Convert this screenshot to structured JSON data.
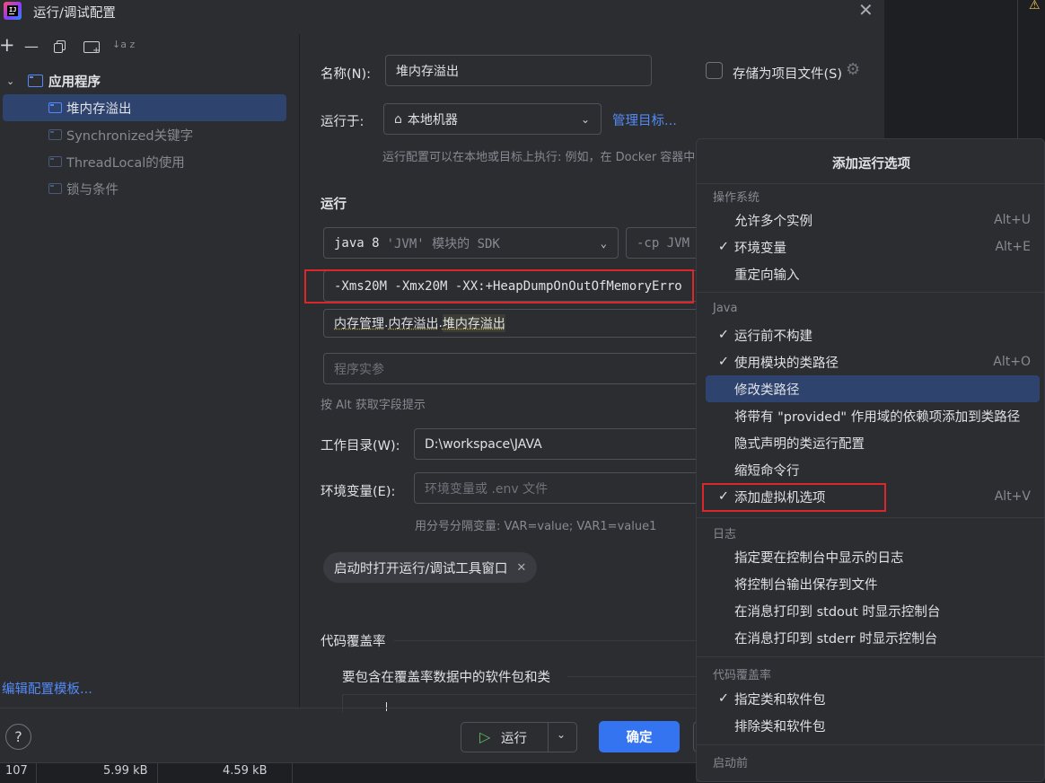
{
  "window": {
    "title": "运行/调试配置"
  },
  "toolbar": {
    "add": "+",
    "remove": "—",
    "sort": "↓a z"
  },
  "tree": {
    "group": "应用程序",
    "items": [
      {
        "label": "堆内存溢出",
        "selected": true
      },
      {
        "label": "Synchronized关键字"
      },
      {
        "label": "ThreadLocal的使用"
      },
      {
        "label": "锁与条件"
      }
    ],
    "edit_templates": "编辑配置模板..."
  },
  "form": {
    "name_label": "名称(N):",
    "name_value": "堆内存溢出",
    "store_as_project": "存储为项目文件(S)",
    "run_on_label": "运行于:",
    "run_on_value": "本地机器",
    "manage_targets": "管理目标...",
    "run_on_hint": "运行配置可以在本地或目标上执行: 例如，在 Docker 容器中或",
    "run_section": "运行",
    "sdk_value": "java 8",
    "sdk_suffix": "'JVM' 模块的 SDK",
    "cp_value": "-cp JVM",
    "vm_options": "-Xms20M -Xmx20M -XX:+HeapDumpOnOutOfMemoryErro",
    "main_class": [
      "内存管理",
      ".",
      "内存溢出",
      ".",
      "堆内存溢出"
    ],
    "program_args_placeholder": "程序实参",
    "alt_hint": "按 Alt 获取字段提示",
    "workdir_label": "工作目录(W):",
    "workdir_value": "D:\\workspace\\JAVA",
    "env_label": "环境变量(E):",
    "env_placeholder": "环境变量或 .env 文件",
    "env_hint": "用分号分隔变量: VAR=value; VAR1=value1",
    "open_tool_window_chip": "启动时打开运行/调试工具窗口",
    "coverage_section": "代码覆盖率",
    "coverage_packages": "要包含在覆盖率数据中的软件包和类"
  },
  "footer": {
    "help": "?",
    "run": "运行",
    "ok": "确定"
  },
  "statusbar": {
    "c1": "107",
    "c2": "5.99 kB",
    "c3": "4.59 kB"
  },
  "menu": {
    "title": "添加运行选项",
    "sections": [
      {
        "header": "操作系统",
        "items": [
          {
            "label": "允许多个实例",
            "shortcut": "Alt+U",
            "checked": false
          },
          {
            "label": "环境变量",
            "shortcut": "Alt+E",
            "checked": true
          },
          {
            "label": "重定向输入",
            "shortcut": "",
            "checked": false
          }
        ]
      },
      {
        "header": "Java",
        "items": [
          {
            "label": "运行前不构建",
            "shortcut": "",
            "checked": true
          },
          {
            "label": "使用模块的类路径",
            "shortcut": "Alt+O",
            "checked": true
          },
          {
            "label": "修改类路径",
            "shortcut": "",
            "checked": false,
            "highlighted": true
          },
          {
            "label": "将带有 \"provided\" 作用域的依赖项添加到类路径",
            "shortcut": "",
            "checked": false
          },
          {
            "label": "隐式声明的类运行配置",
            "shortcut": "",
            "checked": false
          },
          {
            "label": "缩短命令行",
            "shortcut": "",
            "checked": false
          },
          {
            "label": "添加虚拟机选项",
            "shortcut": "Alt+V",
            "checked": true
          }
        ]
      },
      {
        "header": "日志",
        "items": [
          {
            "label": "指定要在控制台中显示的日志",
            "shortcut": "",
            "checked": false
          },
          {
            "label": "将控制台输出保存到文件",
            "shortcut": "",
            "checked": false
          },
          {
            "label": "在消息打印到 stdout 时显示控制台",
            "shortcut": "",
            "checked": false
          },
          {
            "label": "在消息打印到 stderr 时显示控制台",
            "shortcut": "",
            "checked": false
          }
        ]
      },
      {
        "header": "代码覆盖率",
        "items": [
          {
            "label": "指定类和软件包",
            "shortcut": "",
            "checked": true
          },
          {
            "label": "排除类和软件包",
            "shortcut": "",
            "checked": false
          }
        ]
      },
      {
        "header": "启动前",
        "items": []
      }
    ]
  },
  "colors": {
    "accent": "#3574f0",
    "selection": "#2e436e",
    "highlight": "#d9272b",
    "background": "#2b2d30"
  }
}
